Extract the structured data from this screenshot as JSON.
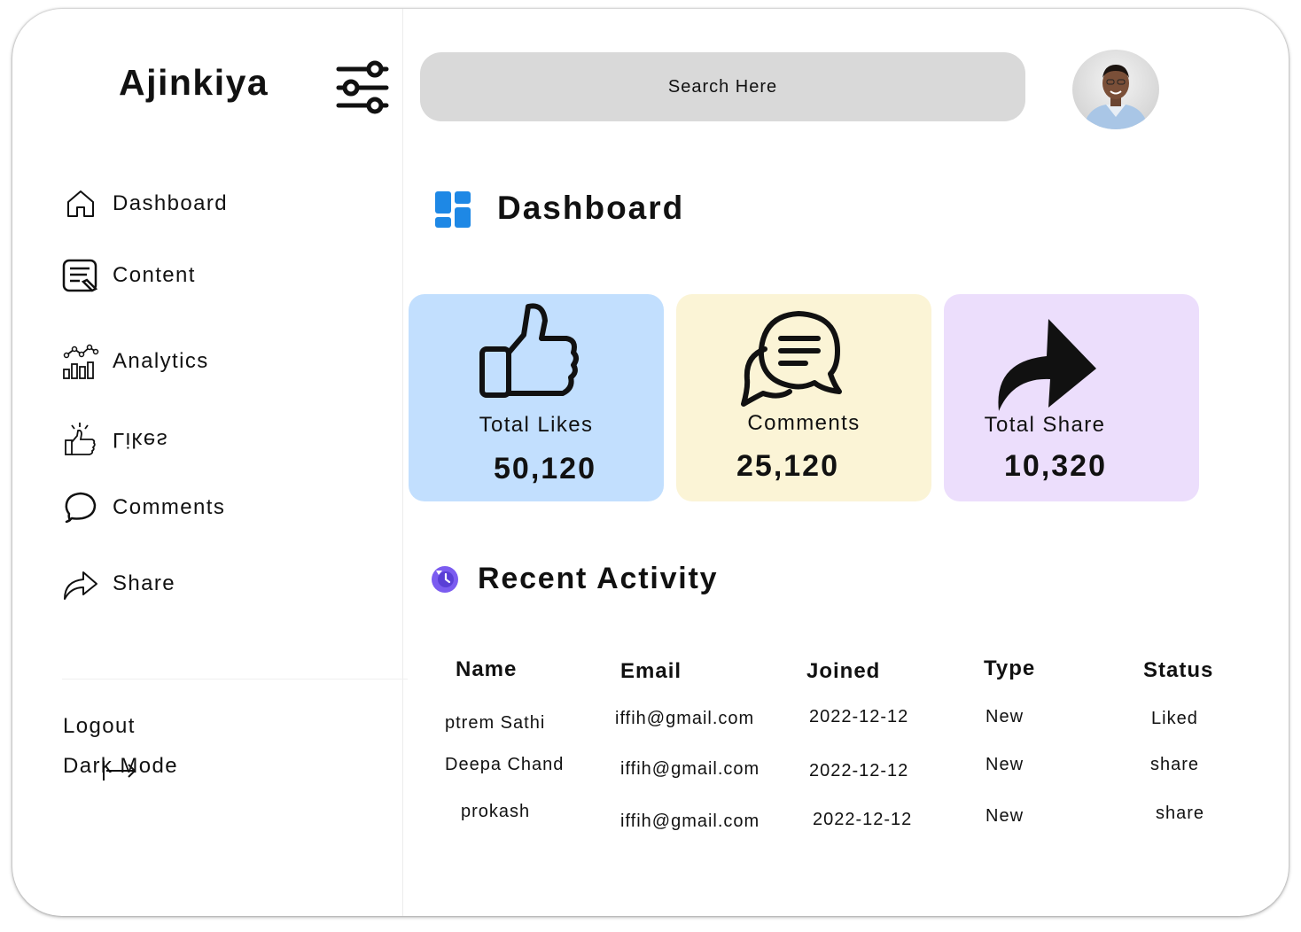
{
  "brand": {
    "name": "Ajinkiya"
  },
  "search": {
    "placeholder": "Search Here"
  },
  "sidebar": {
    "items": [
      {
        "label": "Dashboard",
        "icon": "home-icon"
      },
      {
        "label": "Content",
        "icon": "content-edit-icon"
      },
      {
        "label": "Analytics",
        "icon": "analytics-icon"
      },
      {
        "label": "Likes",
        "icon": "thumbs-up-icon"
      },
      {
        "label": "Comments",
        "icon": "speech-bubble-icon"
      },
      {
        "label": "Share",
        "icon": "share-arrow-icon"
      }
    ],
    "logout": "Logout",
    "dark_mode": "Dark Mode"
  },
  "main": {
    "title": "Dashboard",
    "cards": [
      {
        "label": "Total Likes",
        "value": "50,120",
        "color": "#c2dffe",
        "icon": "thumbs-up-icon"
      },
      {
        "label": "Comments",
        "value": "25,120",
        "color": "#fbf4d6",
        "icon": "comments-icon"
      },
      {
        "label": "Total Share",
        "value": "10,320",
        "color": "#ecdefc",
        "icon": "share-arrow-icon"
      }
    ],
    "recent_activity": {
      "title": "Recent Activity",
      "columns": [
        "Name",
        "Email",
        "Joined",
        "Type",
        "Status"
      ],
      "rows": [
        [
          "ptrem Sathi",
          "iffih@gmail.com",
          "2022-12-12",
          "New",
          "Liked"
        ],
        [
          "Deepa Chand",
          "iffih@gmail.com",
          "2022-12-12",
          "New",
          "share"
        ],
        [
          "prokash",
          "iffih@gmail.com",
          "2022-12-12",
          "New",
          "share"
        ]
      ]
    }
  },
  "colors": {
    "dashboard_icon": "#1e88e5",
    "activity_icon": "#7b5cf0",
    "search_bg": "#d9d9d9"
  }
}
